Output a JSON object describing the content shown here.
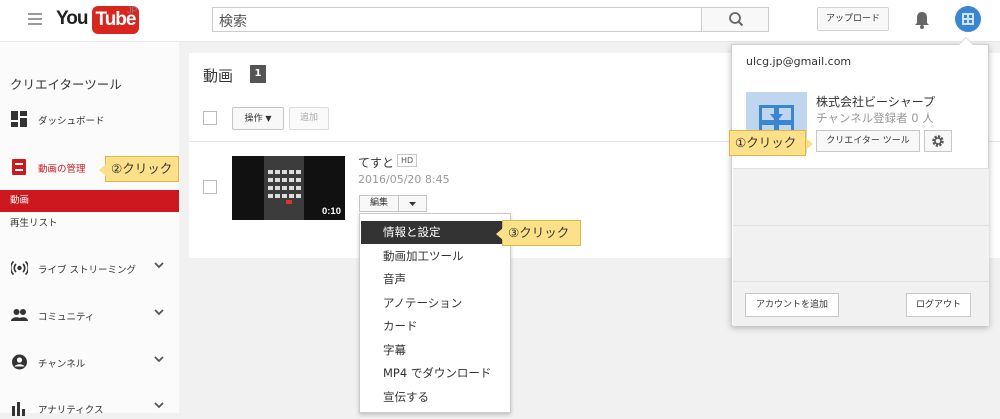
{
  "header": {
    "logo_you": "You",
    "logo_tube": "Tube",
    "logo_region": "JP",
    "search_value": "検索",
    "upload_label": "アップロード"
  },
  "sidebar": {
    "title": "クリエイターツール",
    "items": [
      {
        "label": "ダッシュボード",
        "icon": "dashboard-icon"
      },
      {
        "label": "動画の管理",
        "icon": "video-manager-icon",
        "active": true
      },
      {
        "label": "ライブ ストリーミング",
        "icon": "live-icon"
      },
      {
        "label": "コミュニティ",
        "icon": "community-icon"
      },
      {
        "label": "チャンネル",
        "icon": "channel-icon"
      },
      {
        "label": "アナリティクス",
        "icon": "analytics-icon"
      }
    ],
    "sub_items": [
      {
        "label": "動画",
        "active": true
      },
      {
        "label": "再生リスト",
        "active": false
      }
    ]
  },
  "main": {
    "title": "動画",
    "count": "1",
    "action_label": "操作",
    "add_label": "追加",
    "video": {
      "title": "てすと",
      "hd_badge": "HD",
      "date": "2016/05/20 8:45",
      "duration": "0:10",
      "edit_label": "編集"
    },
    "dropdown": [
      {
        "label": "情報と設定",
        "highlighted": true
      },
      {
        "label": "動画加工ツール",
        "highlighted": false
      },
      {
        "label": "音声",
        "highlighted": false
      },
      {
        "label": "アノテーション",
        "highlighted": false
      },
      {
        "label": "カード",
        "highlighted": false
      },
      {
        "label": "字幕",
        "highlighted": false
      },
      {
        "label": "MP4 でダウンロード",
        "highlighted": false
      },
      {
        "label": "宣伝する",
        "highlighted": false
      }
    ]
  },
  "account_popup": {
    "email": "ulcg.jp@gmail.com",
    "channel_name": "株式会社ビーシャープ",
    "subscribers": "チャンネル登録者 0 人",
    "creator_studio_label": "クリエイター ツール",
    "add_account_label": "アカウントを追加",
    "logout_label": "ログアウト"
  },
  "callouts": {
    "step1": "①クリック",
    "step2": "②クリック",
    "step3": "③クリック"
  },
  "colors": {
    "brand_red": "#cc181e",
    "callout_yellow": "#fce18a",
    "menu_highlight": "#333333"
  }
}
